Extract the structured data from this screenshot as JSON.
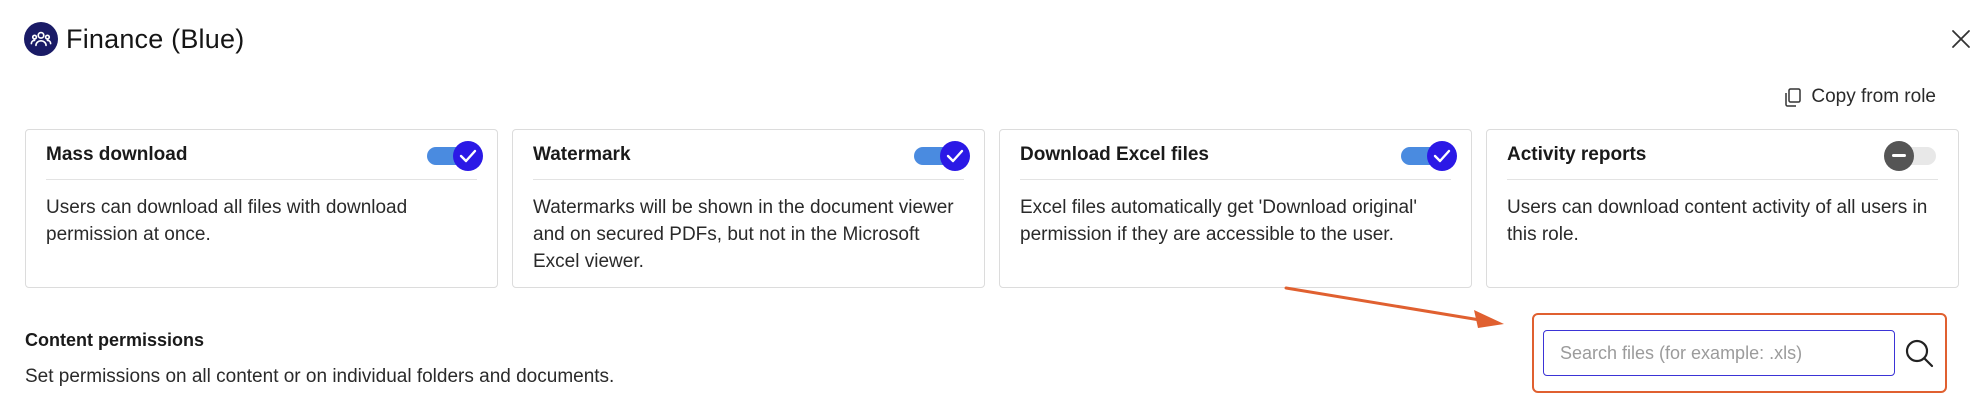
{
  "header": {
    "title": "Finance (Blue)",
    "icon": "group-icon"
  },
  "actions": {
    "copy_from_role": "Copy from role"
  },
  "cards": [
    {
      "title": "Mass download",
      "description": "Users can download all files with download permission at once.",
      "enabled": true
    },
    {
      "title": "Watermark",
      "description": "Watermarks will be shown in the document viewer and on secured PDFs, but not in the Microsoft Excel viewer.",
      "enabled": true
    },
    {
      "title": "Download Excel files",
      "description": "Excel files automatically get 'Download original' permission if they are accessible to the user.",
      "enabled": true
    },
    {
      "title": "Activity reports",
      "description": "Users can download content activity of all users in this role.",
      "enabled": false
    }
  ],
  "content_permissions": {
    "title": "Content permissions",
    "description": "Set permissions on all content or on individual folders and documents."
  },
  "search": {
    "placeholder": "Search files (for example: .xls)",
    "value": ""
  },
  "colors": {
    "accent": "#2b19e6",
    "track_on": "#4a8be0",
    "highlight": "#e06030"
  }
}
